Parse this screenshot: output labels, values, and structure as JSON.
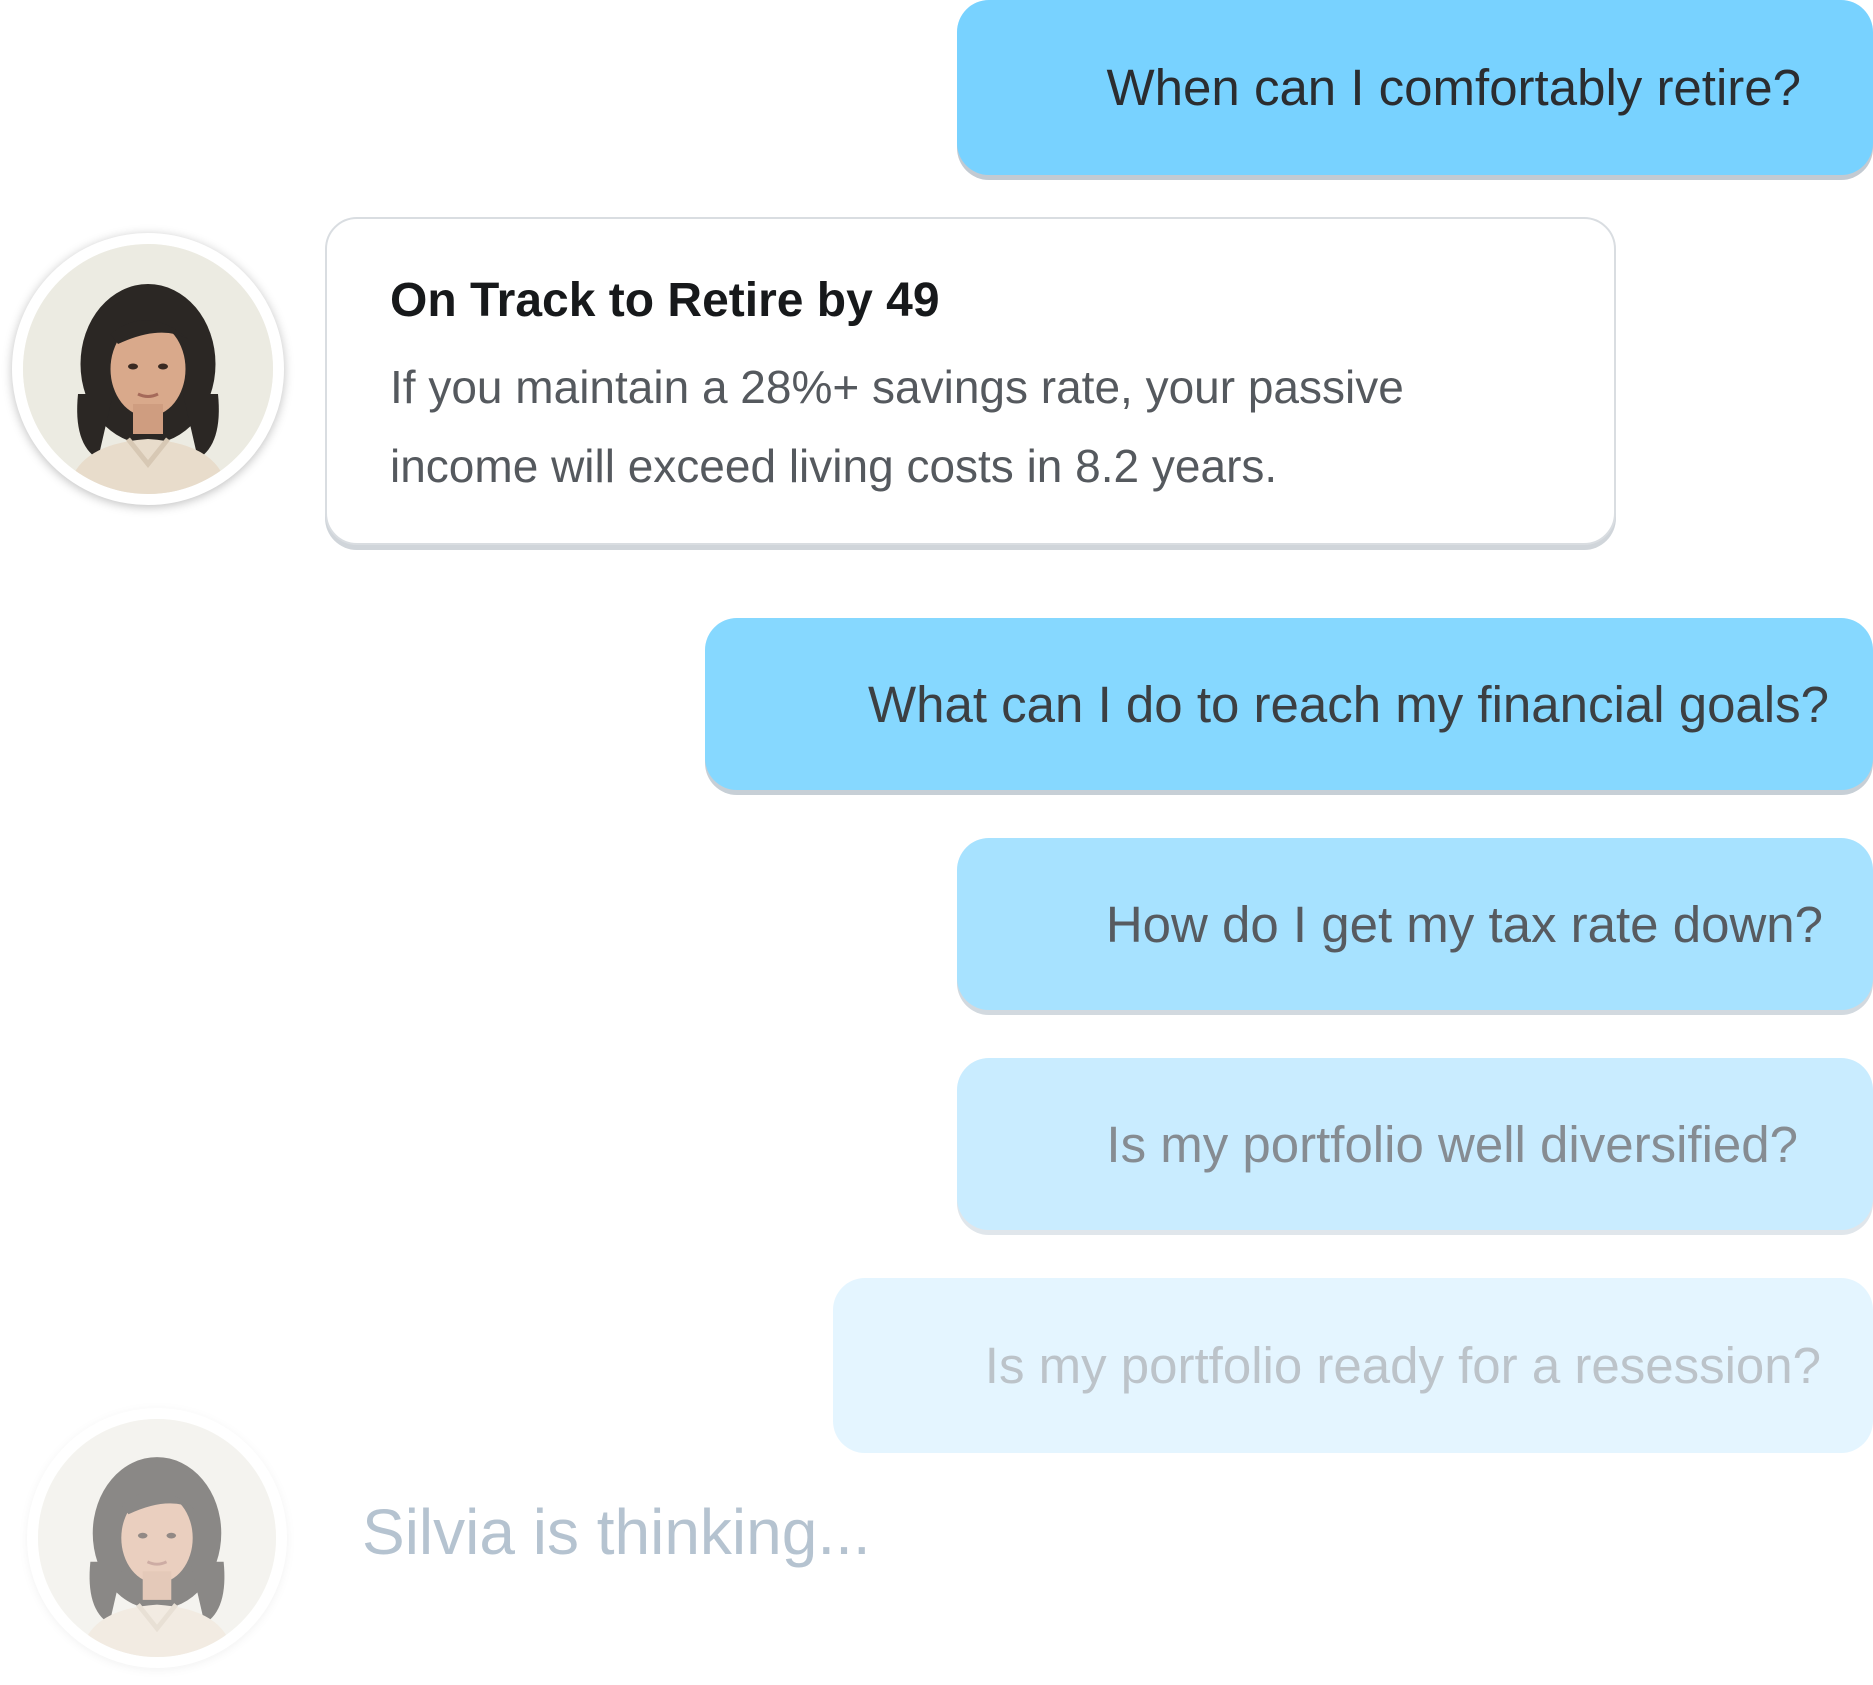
{
  "messages": {
    "q1": "When can I comfortably retire?",
    "q2": "What can I do to reach my financial goals?",
    "q3": "How do I get my tax rate down?",
    "q4": "Is my portfolio well diversified?",
    "q5": "Is my portfolio ready for a resession?"
  },
  "answer": {
    "title": "On Track to Retire by 49",
    "body": "If you maintain a 28%+ savings rate, your passive income will exceed living costs in 8.2 years."
  },
  "status": {
    "thinking": "Silvia is thinking..."
  },
  "colors": {
    "bubble_primary": "#78d2ff",
    "bubble_faded": "#e4f5ff",
    "card_border": "#d9dde1",
    "thinking_text": "#b5c3d0"
  }
}
